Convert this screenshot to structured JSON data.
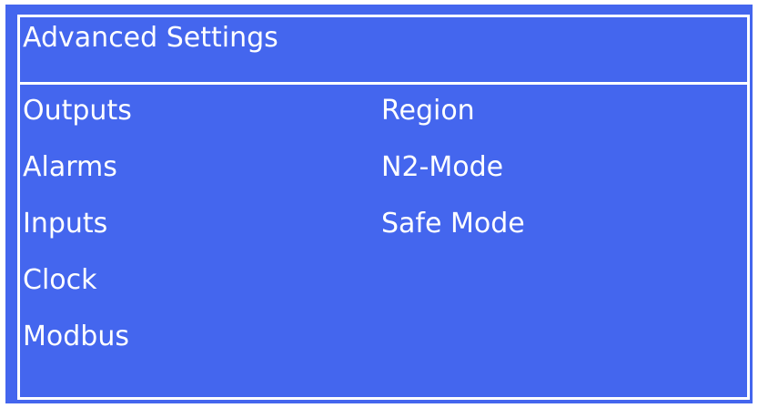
{
  "screen": {
    "title": "Advanced Settings",
    "menu": {
      "left": [
        {
          "label": "Outputs"
        },
        {
          "label": "Alarms"
        },
        {
          "label": "Inputs"
        },
        {
          "label": "Clock"
        },
        {
          "label": "Modbus"
        }
      ],
      "right": [
        {
          "label": "Region"
        },
        {
          "label": "N2-Mode"
        },
        {
          "label": "Safe Mode"
        }
      ]
    }
  },
  "colors": {
    "background": "#4466ee",
    "foreground": "#ffffff"
  }
}
